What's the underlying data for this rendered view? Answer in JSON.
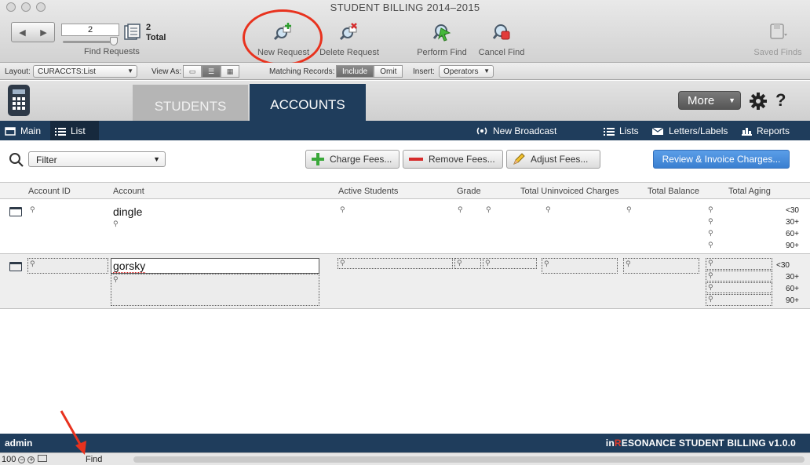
{
  "window": {
    "title": "STUDENT BILLING 2014–2015"
  },
  "toolbar": {
    "record_number": "2",
    "found_count": "2",
    "total_label": "Total",
    "find_requests_label": "Find Requests",
    "new_request": "New Request",
    "delete_request": "Delete Request",
    "perform_find": "Perform Find",
    "cancel_find": "Cancel Find",
    "saved_finds": "Saved Finds"
  },
  "layout_bar": {
    "layout_label": "Layout:",
    "layout_value": "CURACCTS:List",
    "view_as_label": "View As:",
    "matching_label": "Matching Records:",
    "include": "Include",
    "omit": "Omit",
    "insert_label": "Insert:",
    "operators": "Operators"
  },
  "tabs": {
    "students": "STUDENTS",
    "accounts": "ACCOUNTS"
  },
  "header": {
    "more": "More",
    "help": "?"
  },
  "nav": {
    "main": "Main",
    "list": "List",
    "new_broadcast": "New Broadcast",
    "lists": "Lists",
    "letters_labels": "Letters/Labels",
    "reports": "Reports"
  },
  "actions": {
    "filter": "Filter",
    "charge_fees": "Charge Fees...",
    "remove_fees": "Remove Fees...",
    "adjust_fees": "Adjust Fees...",
    "review_invoice": "Review & Invoice Charges..."
  },
  "columns": {
    "account_id": "Account ID",
    "account": "Account",
    "active_students": "Active Students",
    "grade": "Grade",
    "total_uninvoiced": "Total Uninvoiced Charges",
    "total_balance": "Total Balance",
    "total_aging": "Total Aging"
  },
  "records": [
    {
      "account": "dingle",
      "aging": [
        "<30",
        "30+",
        "60+",
        "90+"
      ]
    },
    {
      "account": "gorsky",
      "aging": [
        "<30",
        "30+",
        "60+",
        "90+"
      ]
    }
  ],
  "footer": {
    "user": "admin",
    "brand_prefix": "in",
    "brand_r": "R",
    "brand_rest": "ESONANCE STUDENT BILLING v1.0.0"
  },
  "status": {
    "zoom": "100",
    "mode": "Find"
  },
  "colors": {
    "navy": "#1f3d5c",
    "accent_blue": "#3a7fd0",
    "annotation_red": "#e8321e"
  }
}
